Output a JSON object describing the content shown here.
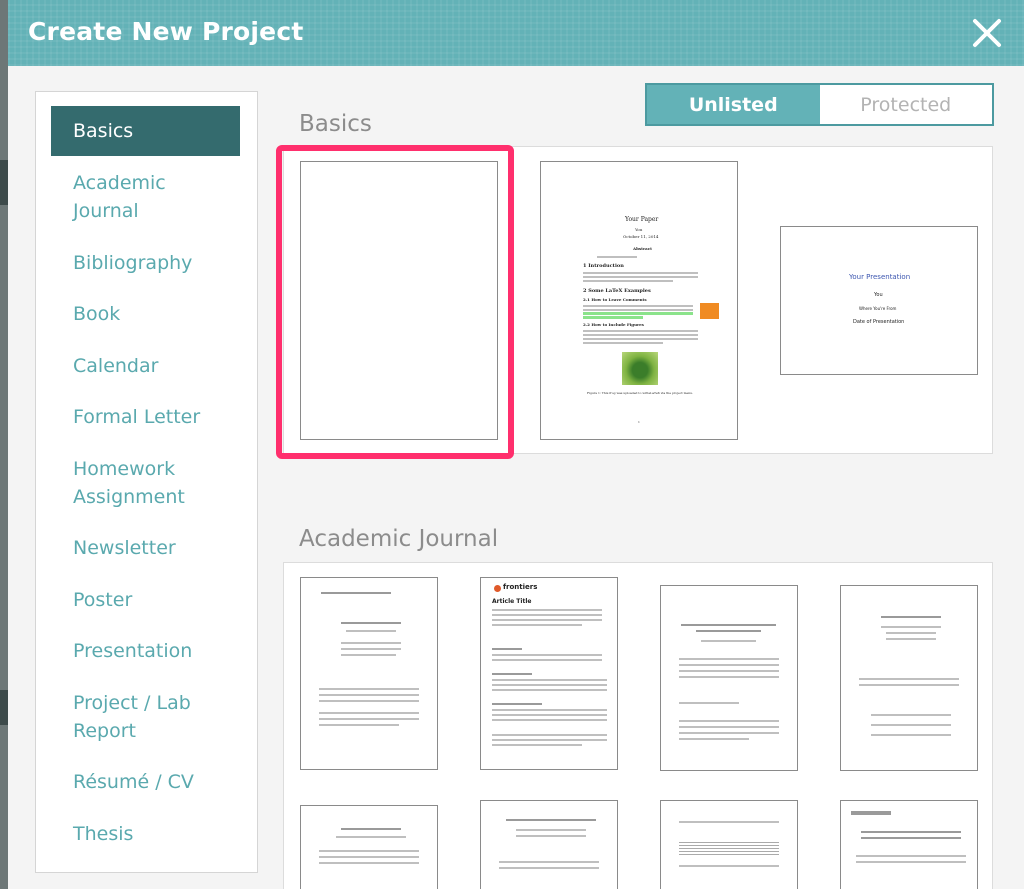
{
  "modal": {
    "title": "Create New Project"
  },
  "sidebar": {
    "items": [
      {
        "lines": [
          "Basics"
        ],
        "active": true
      },
      {
        "lines": [
          "Academic",
          "Journal"
        ]
      },
      {
        "lines": [
          "Bibliography"
        ]
      },
      {
        "lines": [
          "Book"
        ]
      },
      {
        "lines": [
          "Calendar"
        ]
      },
      {
        "lines": [
          "Formal Letter"
        ]
      },
      {
        "lines": [
          "Homework",
          "Assignment"
        ]
      },
      {
        "lines": [
          "Newsletter"
        ]
      },
      {
        "lines": [
          "Poster"
        ]
      },
      {
        "lines": [
          "Presentation"
        ]
      },
      {
        "lines": [
          "Project / Lab",
          "Report"
        ]
      },
      {
        "lines": [
          "Résumé / CV"
        ]
      },
      {
        "lines": [
          "Thesis"
        ]
      }
    ]
  },
  "visibility": {
    "unlisted": "Unlisted",
    "protected": "Protected",
    "selected": "Unlisted"
  },
  "sections": {
    "basics": {
      "title": "Basics"
    },
    "journal": {
      "title": "Academic Journal"
    }
  },
  "templates": {
    "paper": {
      "title": "Your Paper",
      "author": "You",
      "date": "October 11, 2014",
      "abstract": "Abstract",
      "sec1": "1   Introduction",
      "sec2": "2   Some LaTeX Examples",
      "sub1": "2.1   How to Leave Comments",
      "sub2": "2.2   How to Include Figures",
      "caption": "Figure 1: This frog was uploaded to writeLaTeX via the project menu.",
      "page": "1"
    },
    "presentation": {
      "title": "Your Presentation",
      "author": "You",
      "institute": "Where You're From",
      "date": "Date of Presentation"
    },
    "frontiers": {
      "brand": "frontiers",
      "article_title": "Article Title"
    }
  },
  "colors": {
    "accent": "#63b2b7",
    "active_sidebar": "#346b6e",
    "selected_border": "#ff2f6d",
    "link": "#5aa9ae"
  }
}
